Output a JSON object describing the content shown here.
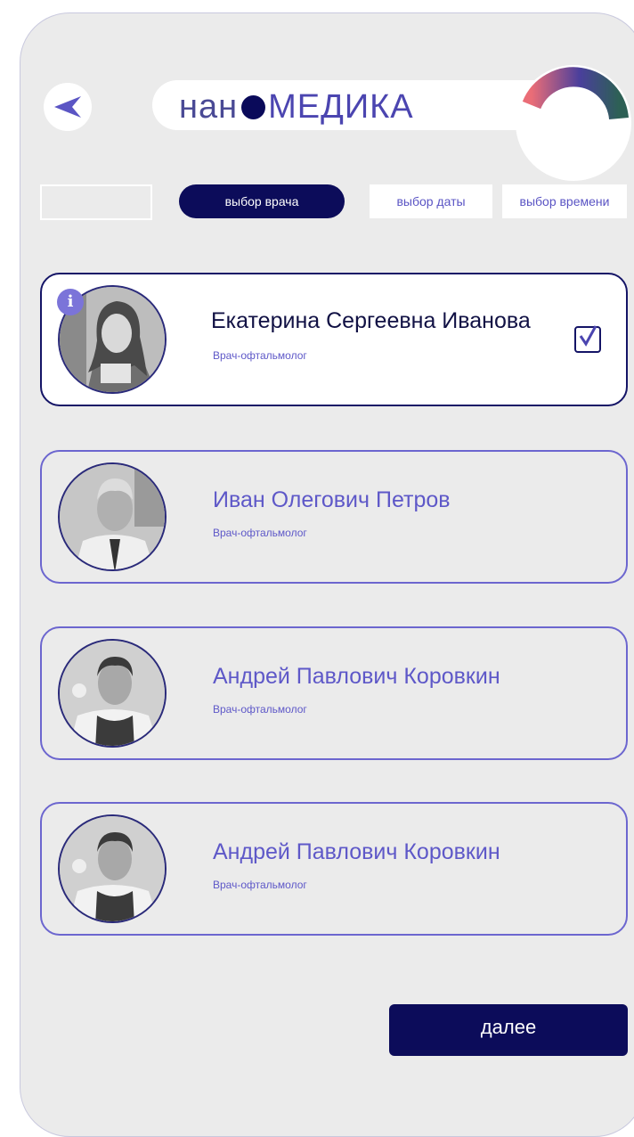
{
  "header": {
    "logo_thin": "нан",
    "logo_bold": "МЕДИКА"
  },
  "steps": {
    "blank": "",
    "doctor": "выбор врача",
    "date": "выбор даты",
    "time": "выбор времени"
  },
  "doctors": [
    {
      "name": "Екатерина Сергеевна Иванова",
      "specialty": "Врач-офтальмолог",
      "selected": true,
      "info": "i"
    },
    {
      "name": "Иван Олегович Петров",
      "specialty": "Врач-офтальмолог",
      "selected": false
    },
    {
      "name": "Андрей Павлович Коровкин",
      "specialty": "Врач-офтальмолог",
      "selected": false
    },
    {
      "name": "Андрей Павлович Коровкин",
      "specialty": "Врач-офтальмолог",
      "selected": false
    }
  ],
  "next_label": "далее",
  "icons": {
    "back": "back-arrow-icon",
    "progress": "progress-ring-icon",
    "info": "info-icon",
    "check": "checkmark-icon"
  },
  "colors": {
    "background": "#ebebeb",
    "primary_dark": "#0c0c5a",
    "accent": "#5e58c8",
    "ring_gradient": [
      "#e06a78",
      "#4d3e9a",
      "#2f5f58"
    ]
  }
}
